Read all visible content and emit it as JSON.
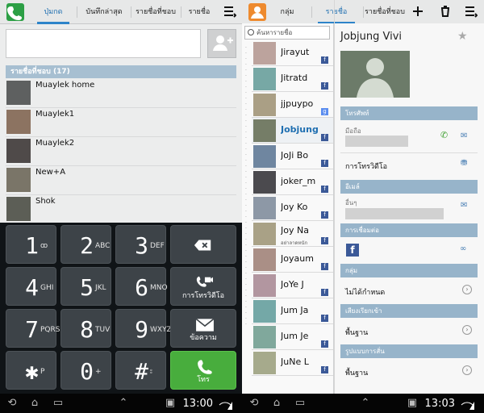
{
  "left": {
    "tabs": [
      {
        "label": "ปุ่มกด",
        "active": true
      },
      {
        "label": "บันทึกล่าสุด",
        "active": false
      },
      {
        "label": "รายชื่อที่ชอบ",
        "active": false
      },
      {
        "label": "รายชื่อ",
        "active": false
      }
    ],
    "favorites_title": "รายชื่อที่ชอบ (17)",
    "favorites": [
      {
        "name": "Muaylek home",
        "avatar_color": "#5e6060"
      },
      {
        "name": "Muaylek1",
        "avatar_color": "#8c7361"
      },
      {
        "name": "Muaylek2",
        "avatar_color": "#4f4a49"
      },
      {
        "name": "New+A",
        "avatar_color": "#7a7568"
      },
      {
        "name": "Shok",
        "avatar_color": "#5c5e56"
      }
    ],
    "keypad": [
      {
        "n": "1",
        "s": "ꝏ"
      },
      {
        "n": "2",
        "s": "ABC"
      },
      {
        "n": "3",
        "s": "DEF"
      },
      {
        "n": "⌫",
        "s": ""
      },
      {
        "n": "4",
        "s": "GHI"
      },
      {
        "n": "5",
        "s": "JKL"
      },
      {
        "n": "6",
        "s": "MNO"
      },
      {
        "n": "",
        "s": "การโทรวิดีโอ"
      },
      {
        "n": "7",
        "s": "PQRS"
      },
      {
        "n": "8",
        "s": "TUV"
      },
      {
        "n": "9",
        "s": "WXYZ"
      },
      {
        "n": "",
        "s": "ข้อความ"
      },
      {
        "n": "✱",
        "s": "P"
      },
      {
        "n": "0",
        "s": "+"
      },
      {
        "n": "#",
        "s": "⦂"
      },
      {
        "n": "",
        "s": "โทร"
      }
    ],
    "status_time": "13:00"
  },
  "right": {
    "tabs": [
      {
        "label": "กลุ่ม",
        "active": false
      },
      {
        "label": "รายชื่อ",
        "active": true
      },
      {
        "label": "รายชื่อที่ชอบ",
        "active": false
      }
    ],
    "search_placeholder": "ค้นหารายชื่อ",
    "contacts": [
      {
        "name": "Jirayut",
        "sub": "",
        "badge": "f",
        "avatar": "#bca39d"
      },
      {
        "name": "Jitratd",
        "sub": "",
        "badge": "f",
        "avatar": "#77a8a5"
      },
      {
        "name": "jjpuypo",
        "sub": "",
        "badge": "g",
        "avatar": "#aa9f85"
      },
      {
        "name": "Jobjung",
        "sub": "",
        "badge": "f",
        "avatar": "#757d67"
      },
      {
        "name": "JoJi Bo",
        "sub": "",
        "badge": "f",
        "avatar": "#6f86a0"
      },
      {
        "name": "joker_m",
        "sub": "",
        "badge": "f",
        "avatar": "#4b4a4e"
      },
      {
        "name": "Joy Ko",
        "sub": "",
        "badge": "f",
        "avatar": "#8d98a6"
      },
      {
        "name": "Joy Na",
        "sub": "อย่าลาดหนัก",
        "badge": "f",
        "avatar": "#a9a186"
      },
      {
        "name": "Joyaum",
        "sub": "",
        "badge": "f",
        "avatar": "#aa8f86"
      },
      {
        "name": "JoYe J",
        "sub": "",
        "badge": "f",
        "avatar": "#b296a0"
      },
      {
        "name": "Jum Ja",
        "sub": "",
        "badge": "f",
        "avatar": "#74a8a7"
      },
      {
        "name": "Jum Je",
        "sub": "",
        "badge": "f",
        "avatar": "#80a89c"
      },
      {
        "name": "JuNe L",
        "sub": "",
        "badge": "f",
        "avatar": "#a6aa8c"
      }
    ],
    "index_letter": "K",
    "detail": {
      "name": "Jobjung Vivi",
      "sections": {
        "phone": "โทรศัพท์",
        "email": "อีเมล์",
        "connections": "การเชื่อมต่อ",
        "group": "กลุ่ม",
        "ringtone": "เสียงเรียกเข้า",
        "vibration": "รูปแบบการสั่น"
      },
      "phone_label": "มือถือ",
      "video_call": "การโทรวิดีโอ",
      "email_label": "อื่นๆ",
      "group_value": "ไม่ได้กำหนด",
      "ringtone_value": "พื้นฐาน",
      "vibration_value": "พื้นฐาน"
    },
    "status_time": "13:03"
  }
}
